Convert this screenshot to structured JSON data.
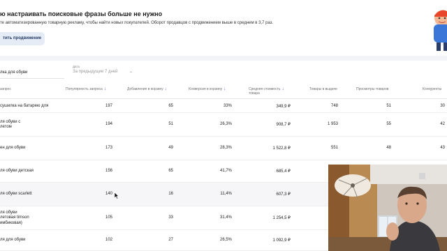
{
  "banner": {
    "title": "ю настраивать поисковые фразы больше не нужно",
    "text": "те автоматизированную товарную рекламу, чтобы найти новых покупателей. Оборот продавцов с продвижением выше в среднем в 3,7 раз.",
    "button_label": "тить продвижение"
  },
  "filters": {
    "search_value": "лка для обуви",
    "date_caption": "Дата",
    "date_value": "За предыдущие 7 дней"
  },
  "table": {
    "headers": {
      "query": "запрос",
      "popularity": "Популярность запроса",
      "add_to_cart": "Добавления в корзину",
      "conversion": "Конверсия в корзину",
      "avg_price_l1": "Средняя стоимость",
      "avg_price_l2": "товара",
      "goods_count": "Товары в выдаче",
      "views": "Просмотры товаров",
      "competitors": "Конкуренты"
    },
    "rows": [
      {
        "name": "сушилка на батарею для",
        "popularity": "197",
        "add_to_cart": "65",
        "conversion": "33%",
        "price": "349,9 ₽",
        "goods": "748",
        "views": "51",
        "competitors": "30"
      },
      {
        "name": "ля обуви с\nлетом",
        "popularity": "194",
        "add_to_cart": "51",
        "conversion": "26,3%",
        "price": "908,7 ₽",
        "goods": "1 953",
        "views": "55",
        "competitors": "42"
      },
      {
        "name": "ен для обуви",
        "popularity": "173",
        "add_to_cart": "49",
        "conversion": "28,3%",
        "price": "1 522,8 ₽",
        "goods": "551",
        "views": "48",
        "competitors": "43"
      },
      {
        "name": "ля обуви детская",
        "popularity": "156",
        "add_to_cart": "65",
        "conversion": "41,7%",
        "price": "685,4 ₽",
        "goods": "",
        "views": "",
        "competitors": ""
      },
      {
        "name": "ля обуви scarlett",
        "popularity": "140",
        "add_to_cart": "16",
        "conversion": "11,4%",
        "price": "607,3 ₽",
        "goods": "",
        "views": "",
        "competitors": ""
      },
      {
        "name": "ля обуви\nлетовая timson\nимбиковая)",
        "popularity": "105",
        "add_to_cart": "33",
        "conversion": "31,4%",
        "price": "1 254,5 ₽",
        "goods": "",
        "views": "",
        "competitors": ""
      },
      {
        "name": "ля для обуви",
        "popularity": "102",
        "add_to_cart": "27",
        "conversion": "26,5%",
        "price": "1 092,9 ₽",
        "goods": "",
        "views": "",
        "competitors": ""
      }
    ]
  },
  "icons": {
    "sort": "sort-arrow-down-icon",
    "chevron": "chevron-down-icon",
    "cursor": "mouse-pointer-icon",
    "mascot": "mascot-figure"
  },
  "colors": {
    "accent": "#3a64c8",
    "button_bg": "#e6ecf6",
    "row_highlight": "#f6f6f8"
  }
}
